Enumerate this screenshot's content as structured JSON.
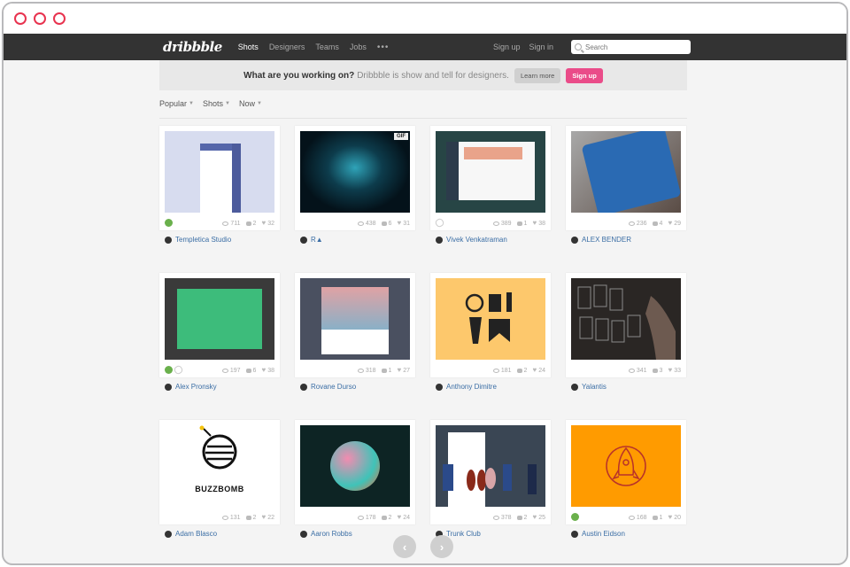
{
  "nav": {
    "logo": "dribbble",
    "links": [
      "Shots",
      "Designers",
      "Teams",
      "Jobs"
    ],
    "more": "•••",
    "signup": "Sign up",
    "signin": "Sign in",
    "search_placeholder": "Search"
  },
  "banner": {
    "question": "What are you working on?",
    "text": "Dribbble is show and tell for designers.",
    "learn_more": "Learn more",
    "signup": "Sign up"
  },
  "filters": [
    "Popular",
    "Shots",
    "Now"
  ],
  "shots": [
    {
      "views": "711",
      "comments": "2",
      "likes": "32",
      "author": "Templetica Studio"
    },
    {
      "views": "438",
      "comments": "6",
      "likes": "31",
      "author": "R▲",
      "badge": "GIF"
    },
    {
      "views": "389",
      "comments": "1",
      "likes": "38",
      "author": "Vivek Venkatraman"
    },
    {
      "views": "236",
      "comments": "4",
      "likes": "29",
      "author": "ALEX BENDER"
    },
    {
      "views": "197",
      "comments": "6",
      "likes": "38",
      "author": "Alex Pronsky"
    },
    {
      "views": "318",
      "comments": "1",
      "likes": "27",
      "author": "Rovane Durso"
    },
    {
      "views": "181",
      "comments": "2",
      "likes": "24",
      "author": "Anthony Dimitre"
    },
    {
      "views": "341",
      "comments": "3",
      "likes": "33",
      "author": "Yalantis"
    },
    {
      "views": "131",
      "comments": "2",
      "likes": "22",
      "author": "Adam Blasco",
      "thumb_text": "BUZZBOMB"
    },
    {
      "views": "178",
      "comments": "2",
      "likes": "24",
      "author": "Aaron Robbs"
    },
    {
      "views": "378",
      "comments": "2",
      "likes": "25",
      "author": "Trunk Club"
    },
    {
      "views": "168",
      "comments": "1",
      "likes": "20",
      "author": "Austin Eidson"
    }
  ],
  "pager": {
    "prev": "‹",
    "next": "›"
  },
  "colors": {
    "accent_pink": "#ea4c89",
    "nav_bg": "#333333",
    "link_blue": "#3b6ea5",
    "window_dot": "#e8334f"
  }
}
